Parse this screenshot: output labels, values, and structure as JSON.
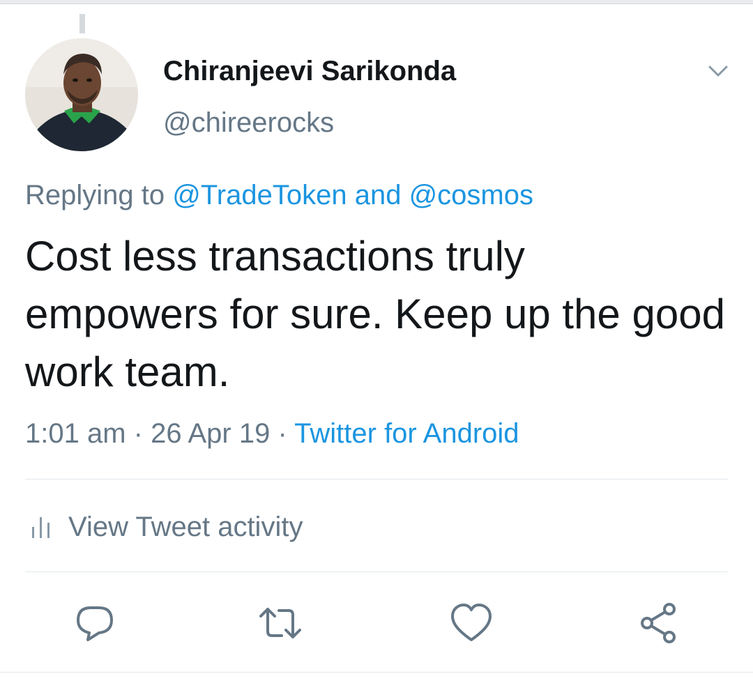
{
  "tweet": {
    "author": {
      "display_name": "Chiranjeevi Sarikonda",
      "handle": "@chireerocks"
    },
    "replying": {
      "prefix": "Replying to ",
      "first": "@TradeToken",
      "joiner": " and ",
      "second": "@cosmos"
    },
    "text": "Cost less transactions truly empowers for sure. Keep up the good work team.",
    "meta": {
      "time": "1:01 am",
      "separator": " · ",
      "date": "26 Apr 19",
      "source": "Twitter for Android"
    },
    "activity_label": "View Tweet activity"
  },
  "icons": {
    "menu": "chevron-down-icon",
    "activity": "bar-chart-icon",
    "reply": "reply-icon",
    "retweet": "retweet-icon",
    "like": "heart-icon",
    "share": "share-icon"
  },
  "colors": {
    "link": "#1b95e0",
    "secondary_text": "#657786",
    "primary_text": "#14171a",
    "divider": "#e1e8ed"
  }
}
